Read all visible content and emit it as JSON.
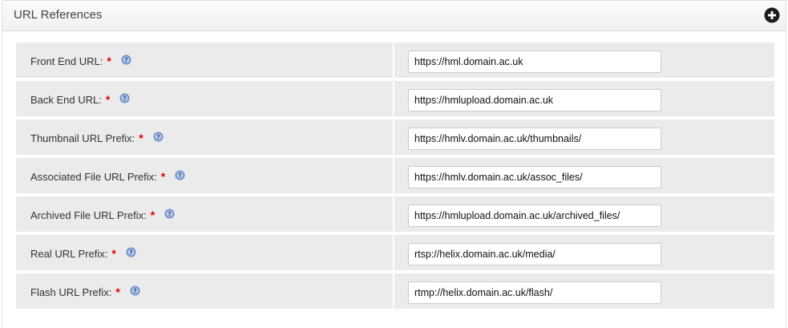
{
  "panel": {
    "title": "URL References",
    "expand_icon": "plus-circle-icon"
  },
  "fields": [
    {
      "label": "Front End URL:",
      "required": "*",
      "value": "https://hml.domain.ac.uk"
    },
    {
      "label": "Back End URL:",
      "required": "*",
      "value": "https://hmlupload.domain.ac.uk"
    },
    {
      "label": "Thumbnail URL Prefix:",
      "required": "*",
      "value": "https://hmlv.domain.ac.uk/thumbnails/"
    },
    {
      "label": "Associated File URL Prefix:",
      "required": "*",
      "value": "https://hmlv.domain.ac.uk/assoc_files/"
    },
    {
      "label": "Archived File URL Prefix:",
      "required": "*",
      "value": "https://hmlupload.domain.ac.uk/archived_files/"
    },
    {
      "label": "Real URL Prefix:",
      "required": "*",
      "value": "rtsp://helix.domain.ac.uk/media/"
    },
    {
      "label": "Flash URL Prefix:",
      "required": "*",
      "value": "rtmp://helix.domain.ac.uk/flash/"
    }
  ],
  "icons": {
    "help": "help-icon"
  },
  "colors": {
    "required": "#e00000",
    "help_icon": "#6f8fc7",
    "row_background": "#ebebeb"
  }
}
